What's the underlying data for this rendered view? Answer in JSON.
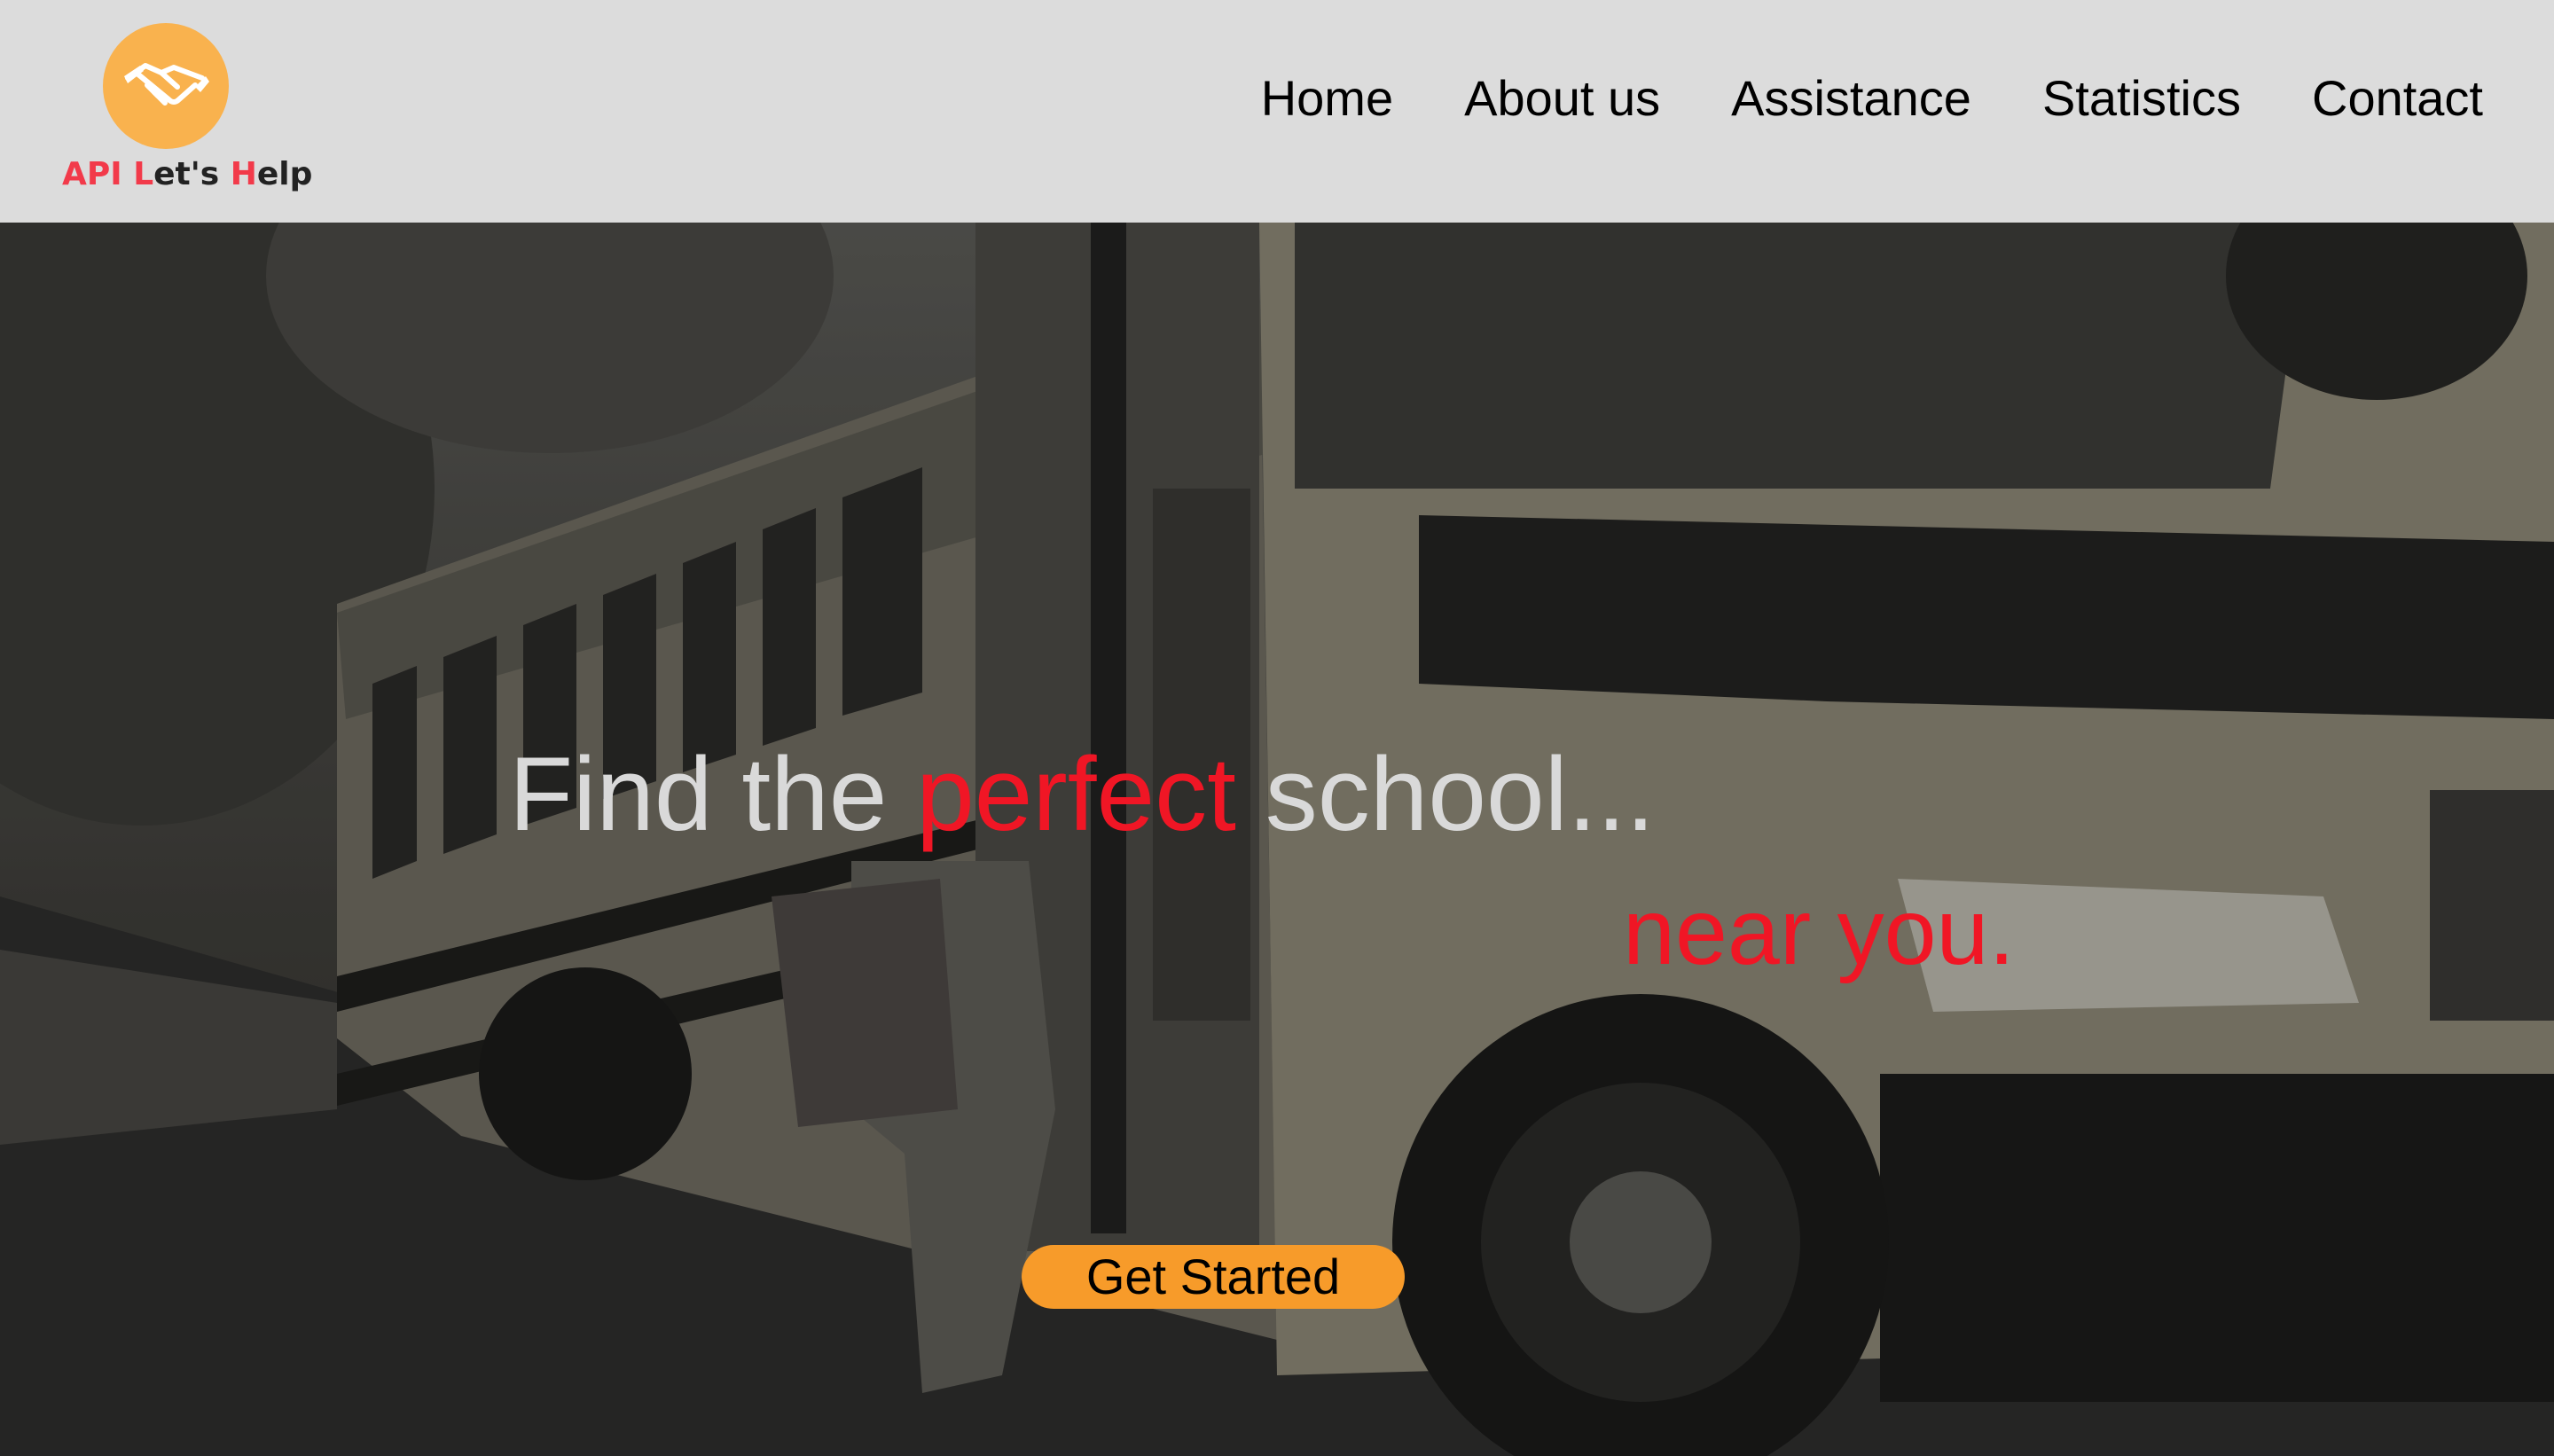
{
  "brand": {
    "logo_icon": "handshake-icon",
    "name_parts": [
      "A",
      "PI ",
      "L",
      "et's ",
      "H",
      "elp"
    ],
    "accent_color": "#f23a4a",
    "logo_color": "#f9b24e"
  },
  "nav": {
    "items": [
      {
        "label": "Home"
      },
      {
        "label": "About us"
      },
      {
        "label": "Assistance"
      },
      {
        "label": "Statistics"
      },
      {
        "label": "Contact"
      }
    ]
  },
  "hero": {
    "headline_start": "Find the ",
    "headline_accent": "perfect",
    "headline_end": " school...",
    "subline": "near you.",
    "cta_label": "Get Started",
    "accent_color": "#f01625",
    "cta_color": "#f79b2a",
    "background": "school-bus-photo"
  }
}
